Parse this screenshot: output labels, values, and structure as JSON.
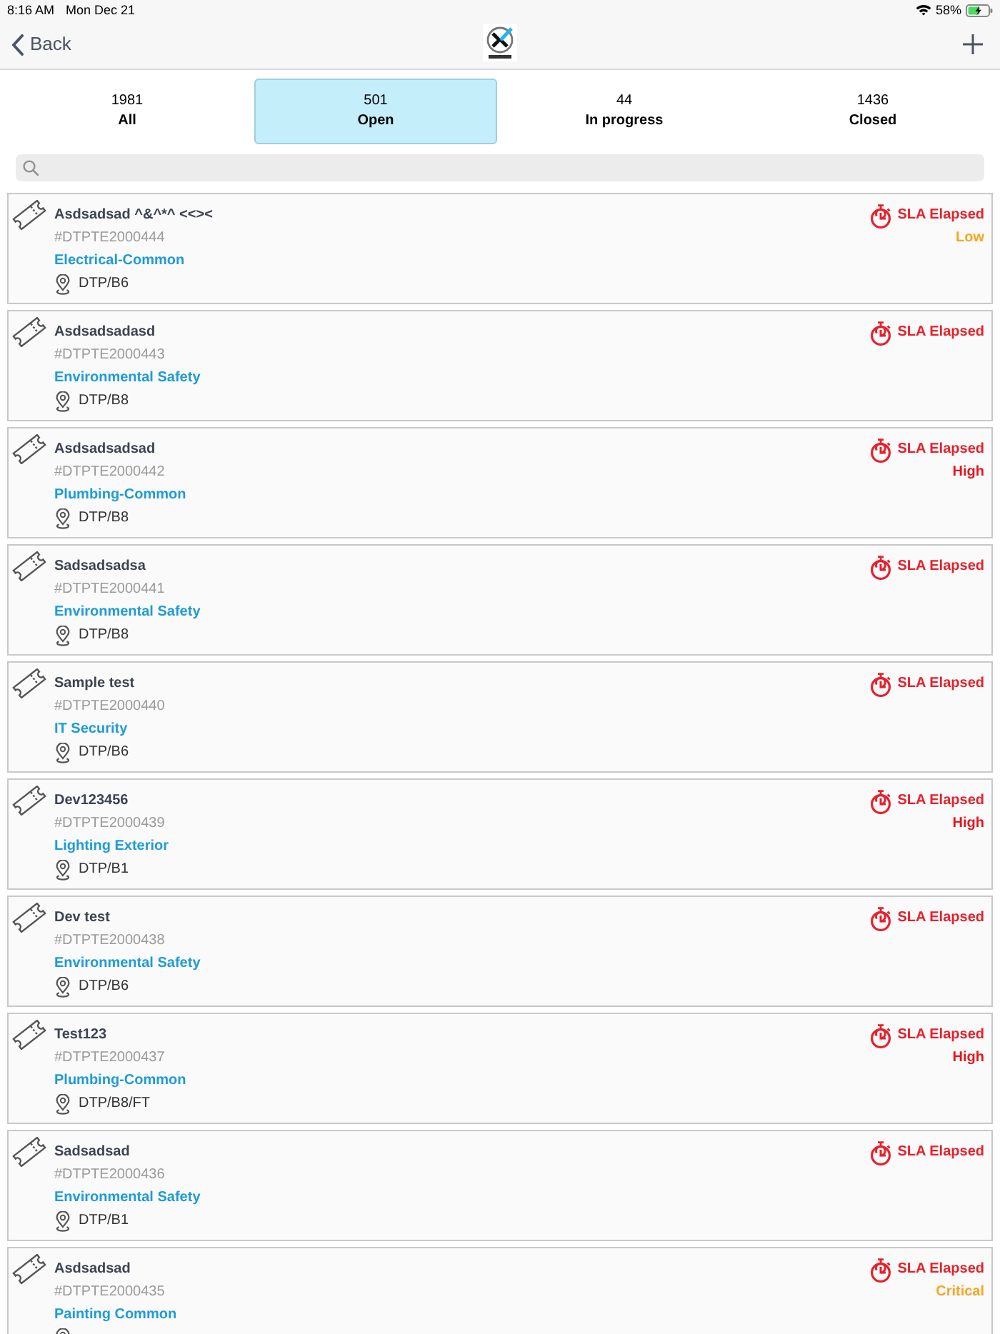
{
  "status_bar": {
    "time": "8:16 AM",
    "date": "Mon Dec 21",
    "battery": "58%"
  },
  "nav": {
    "back": "Back"
  },
  "tabs": [
    {
      "count": "1981",
      "label": "All",
      "selected": false
    },
    {
      "count": "501",
      "label": "Open",
      "selected": true
    },
    {
      "count": "44",
      "label": "In progress",
      "selected": false
    },
    {
      "count": "1436",
      "label": "Closed",
      "selected": false
    }
  ],
  "tickets": [
    {
      "title": "Asdsadsad ^&^*^ <<><",
      "id": "#DTPTE2000444",
      "category": "Electrical-Common",
      "location": "DTP/B6",
      "sla": "SLA Elapsed",
      "priority": {
        "label": "Low",
        "color": "#f5a623"
      }
    },
    {
      "title": "Asdsadsadasd",
      "id": "#DTPTE2000443",
      "category": "Environmental Safety",
      "location": "DTP/B8",
      "sla": "SLA Elapsed"
    },
    {
      "title": "Asdsadsadsad",
      "id": "#DTPTE2000442",
      "category": "Plumbing-Common",
      "location": "DTP/B8",
      "sla": "SLA Elapsed",
      "priority": {
        "label": "High",
        "color": "#e8141c"
      }
    },
    {
      "title": "Sadsadsadsa",
      "id": "#DTPTE2000441",
      "category": "Environmental Safety",
      "location": "DTP/B8",
      "sla": "SLA Elapsed"
    },
    {
      "title": "Sample test",
      "id": "#DTPTE2000440",
      "category": "IT Security",
      "location": "DTP/B6",
      "sla": "SLA Elapsed"
    },
    {
      "title": "Dev123456",
      "id": "#DTPTE2000439",
      "category": "Lighting Exterior",
      "location": "DTP/B1",
      "sla": "SLA Elapsed",
      "priority": {
        "label": "High",
        "color": "#e8141c"
      }
    },
    {
      "title": "Dev test",
      "id": "#DTPTE2000438",
      "category": "Environmental Safety",
      "location": "DTP/B6",
      "sla": "SLA Elapsed"
    },
    {
      "title": "Test123",
      "id": "#DTPTE2000437",
      "category": "Plumbing-Common",
      "location": "DTP/B8/FT",
      "sla": "SLA Elapsed",
      "priority": {
        "label": "High",
        "color": "#e8141c"
      }
    },
    {
      "title": "Sadsadsad",
      "id": "#DTPTE2000436",
      "category": "Environmental Safety",
      "location": "DTP/B1",
      "sla": "SLA Elapsed"
    },
    {
      "title": "Asdsadsad",
      "id": "#DTPTE2000435",
      "category": "Painting Common",
      "sla": "SLA Elapsed",
      "priority": {
        "label": "Critical",
        "color": "#f5a623"
      }
    }
  ]
}
